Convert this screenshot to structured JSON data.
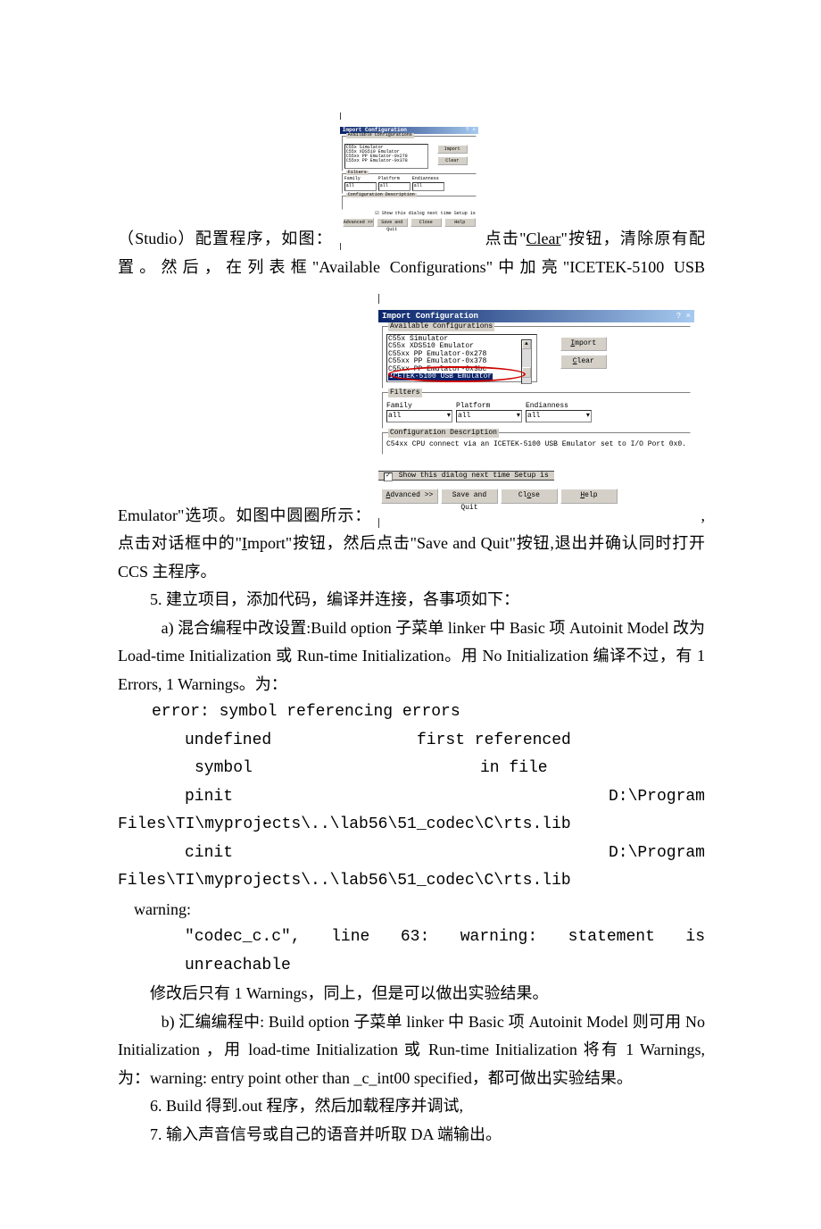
{
  "doc": {
    "p1_pre": "（Studio）配置程序，如图：",
    "p1_post_a": "点击\"",
    "p1_clear": "Clear",
    "p1_post_b": "\"按钮，清除原有配置。然后，在列表框\"Available Configurations\"中加亮\"ICETEK-5100 USB Emulator\"选项。如图中圆圈所示：",
    "p1_after": ",点击对话框中的\"",
    "p1_import_u": "I",
    "p1_import_rest": "mport\"按钮，然后点击\"Save and Quit\"按钮,退出并确认同时打开 CCS 主程序。",
    "s5": "5. 建立项目，添加代码，编译并连接，各事项如下：",
    "s5a": "a) 混合编程中改设置:Build option 子菜单 linker 中 Basic 项 Autoinit Model 改为 Load-time Initialization 或 Run-time Initialization。用 No Initialization 编译不过，有 1 Errors, 1 Warnings。为：",
    "err_hdr": "error: symbol referencing errors",
    "err_c1": "undefined",
    "err_c2": "first referenced",
    "err_c1b": "symbol",
    "err_c2b": "in file",
    "err_r1a": "pinit",
    "err_r1b": "D:\\Program",
    "err_path": "Files\\TI\\myprojects\\..\\lab56\\51_codec\\C\\rts.lib",
    "err_r2a": "cinit",
    "err_r2b": "D:\\Program",
    "warn_hdr": "warning:",
    "warn_body": "\"codec_c.c\", line 63: warning: statement is unreachable",
    "s5a_end": "修改后只有 1 Warnings，同上，但是可以做出实验结果。",
    "s5b": "b) 汇编编程中: Build option 子菜单 linker 中 Basic 项 Autoinit Model 则可用 No Initialization ，用 load-time Initialization 或 Run-time Initialization 将有 1 Warnings,为：warning: entry point other than _c_int00 specified，都可做出实验结果。",
    "s6": "6. Build 得到.out 程序，然后加载程序并调试,",
    "s7": "7. 输入声音信号或自己的语音并听取 DA 端输出。"
  },
  "dlg": {
    "title": "Import Configuration",
    "help_q": "?",
    "close_x": "×",
    "grp_avail": "Available Configurations",
    "list": [
      "C55x Simulator",
      "C55x XDS510 Emulator",
      "C55xx PP Emulator-0x278",
      "C55xx PP Emulator-0x378",
      "C55xx PP Emulator-0x3bc"
    ],
    "list_sel": "ICETEK-5100 USB Emulator",
    "btn_import": "Import",
    "btn_clear": "Clear",
    "grp_filters": "Filters",
    "f_family": "Family",
    "f_platform": "Platform",
    "f_endian": "Endianness",
    "combo_all": "all",
    "grp_desc": "Configuration Description",
    "desc_text": "C54xx CPU connect via an ICETEK-5100 USB Emulator set to I/O Port 0x0.",
    "cb_label": "Show this dialog next time Setup is",
    "cb_check": "✓",
    "btn_adv": "Advanced >>",
    "btn_save": "Save and Quit",
    "btn_close": "Close",
    "btn_help": "Help",
    "sb_up": "▲",
    "sb_dn": "▼",
    "combo_arrow": "▾"
  }
}
